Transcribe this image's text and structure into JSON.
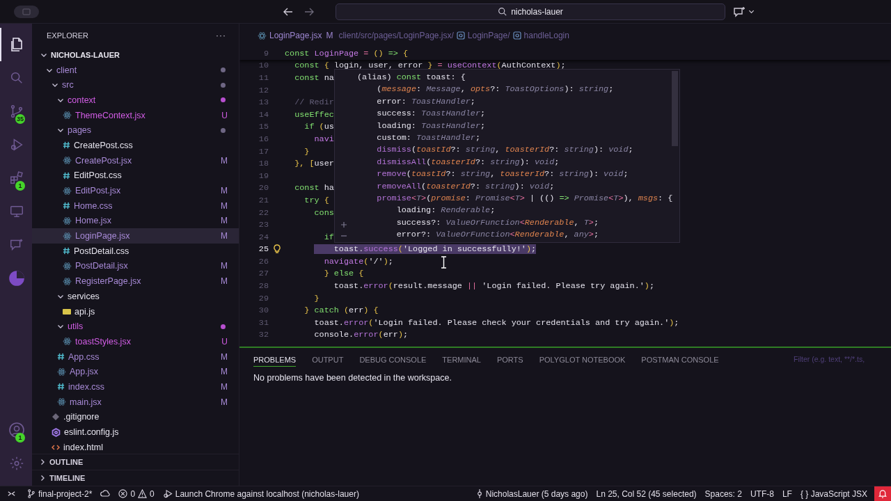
{
  "title_bar": {
    "search": "nicholas-lauer"
  },
  "activity_bar": {
    "top": [
      {
        "kind": "files",
        "selected": true
      },
      {
        "kind": "search",
        "selected": false
      },
      {
        "kind": "source-control",
        "selected": false,
        "badge": "35"
      },
      {
        "kind": "run-debug",
        "selected": false
      },
      {
        "kind": "extensions",
        "selected": false,
        "badge": "1"
      },
      {
        "kind": "remote",
        "selected": false
      },
      {
        "kind": "chat",
        "selected": false
      },
      {
        "kind": "pie",
        "selected": false
      }
    ],
    "bottom": [
      {
        "kind": "account",
        "selected": false,
        "badge": "1"
      },
      {
        "kind": "settings",
        "selected": false
      }
    ]
  },
  "explorer": {
    "title": "EXPLORER",
    "more": "···",
    "root": {
      "label": "NICHOLAS-LAUER",
      "kind": "folder",
      "expanded": true,
      "modified": false,
      "untracked": false,
      "selected": false,
      "children": [
        {
          "label": "client",
          "kind": "folder",
          "expanded": true,
          "modified": true,
          "untracked": false,
          "selected": false,
          "children": [
            {
              "label": "src",
              "kind": "folder",
              "expanded": true,
              "modified": true,
              "untracked": false,
              "selected": false,
              "children": [
                {
                  "label": "context",
                  "kind": "folder",
                  "expanded": true,
                  "modified": false,
                  "untracked": true,
                  "selected": false,
                  "children": [
                    {
                      "label": "ThemeContext.jsx",
                      "kind": "react",
                      "modified": false,
                      "untracked": true,
                      "badge": "U",
                      "selected": false
                    }
                  ]
                },
                {
                  "label": "pages",
                  "kind": "folder",
                  "expanded": true,
                  "modified": true,
                  "untracked": false,
                  "selected": false,
                  "children": [
                    {
                      "label": "CreatePost.css",
                      "kind": "css",
                      "modified": false,
                      "untracked": false,
                      "selected": false
                    },
                    {
                      "label": "CreatePost.jsx",
                      "kind": "react",
                      "modified": true,
                      "untracked": false,
                      "badge": "M",
                      "selected": false
                    },
                    {
                      "label": "EditPost.css",
                      "kind": "css",
                      "modified": false,
                      "untracked": false,
                      "selected": false
                    },
                    {
                      "label": "EditPost.jsx",
                      "kind": "react",
                      "modified": true,
                      "untracked": false,
                      "badge": "M",
                      "selected": false
                    },
                    {
                      "label": "Home.css",
                      "kind": "css",
                      "modified": true,
                      "untracked": false,
                      "badge": "M",
                      "selected": false
                    },
                    {
                      "label": "Home.jsx",
                      "kind": "react",
                      "modified": true,
                      "untracked": false,
                      "badge": "M",
                      "selected": false
                    },
                    {
                      "label": "LoginPage.jsx",
                      "kind": "react",
                      "modified": true,
                      "untracked": false,
                      "badge": "M",
                      "selected": true
                    },
                    {
                      "label": "PostDetail.css",
                      "kind": "css",
                      "modified": false,
                      "untracked": false,
                      "selected": false
                    },
                    {
                      "label": "PostDetail.jsx",
                      "kind": "react",
                      "modified": true,
                      "untracked": false,
                      "badge": "M",
                      "selected": false
                    },
                    {
                      "label": "RegisterPage.jsx",
                      "kind": "react",
                      "modified": true,
                      "untracked": false,
                      "badge": "M",
                      "selected": false
                    }
                  ]
                },
                {
                  "label": "services",
                  "kind": "folder",
                  "expanded": true,
                  "modified": false,
                  "untracked": false,
                  "selected": false,
                  "children": [
                    {
                      "label": "api.js",
                      "kind": "js",
                      "modified": false,
                      "untracked": false,
                      "selected": false
                    }
                  ]
                },
                {
                  "label": "utils",
                  "kind": "folder",
                  "expanded": true,
                  "modified": false,
                  "untracked": true,
                  "selected": false,
                  "children": [
                    {
                      "label": "toastStyles.jsx",
                      "kind": "react",
                      "modified": false,
                      "untracked": true,
                      "badge": "U",
                      "selected": false
                    }
                  ]
                },
                {
                  "label": "App.css",
                  "kind": "css",
                  "modified": true,
                  "untracked": false,
                  "badge": "M",
                  "selected": false
                },
                {
                  "label": "App.jsx",
                  "kind": "react",
                  "modified": true,
                  "untracked": false,
                  "badge": "M",
                  "selected": false
                },
                {
                  "label": "index.css",
                  "kind": "css",
                  "modified": true,
                  "untracked": false,
                  "badge": "M",
                  "selected": false
                },
                {
                  "label": "main.jsx",
                  "kind": "react",
                  "modified": true,
                  "untracked": false,
                  "badge": "M",
                  "selected": false
                }
              ]
            },
            {
              "label": ".gitignore",
              "kind": "git",
              "modified": false,
              "untracked": false,
              "selected": false
            },
            {
              "label": "eslint.config.js",
              "kind": "eslint",
              "modified": false,
              "untracked": false,
              "selected": false
            },
            {
              "label": "index.html",
              "kind": "html",
              "modified": false,
              "untracked": false,
              "selected": false
            }
          ]
        }
      ]
    },
    "sections": [
      {
        "label": "OUTLINE",
        "expanded": false
      },
      {
        "label": "TIMELINE",
        "expanded": false
      }
    ]
  },
  "breadcrumbs": {
    "file": "LoginPage.jsx",
    "badge": "M",
    "path": "client/src/pages/LoginPage.jsx/",
    "symbols": [
      "LoginPage/",
      "handleLogin"
    ]
  },
  "editor": {
    "sticky_line": {
      "number": "9",
      "tokens": [
        {
          "kind": "kw",
          "text": "const "
        },
        {
          "kind": "fn",
          "text": "LoginPage"
        },
        {
          "kind": "op",
          "text": " = "
        },
        {
          "kind": "punc",
          "text": "() "
        },
        {
          "kind": "kw",
          "text": "=> "
        },
        {
          "kind": "punc",
          "text": "{"
        }
      ]
    },
    "lines": [
      {
        "number": "10",
        "selected": false,
        "tokens": [
          {
            "kind": "kw",
            "text": "  const "
          },
          {
            "kind": "punc",
            "text": "{ "
          },
          {
            "kind": "plain",
            "text": "login, user, error "
          },
          {
            "kind": "punc",
            "text": "} "
          },
          {
            "kind": "op",
            "text": "= "
          },
          {
            "kind": "fn",
            "text": "useContext"
          },
          {
            "kind": "punc",
            "text": "("
          },
          {
            "kind": "plain",
            "text": "AuthContext"
          },
          {
            "kind": "punc",
            "text": ")"
          },
          {
            "kind": "plain",
            "text": ";"
          }
        ]
      },
      {
        "number": "11",
        "selected": false,
        "tokens": [
          {
            "kind": "kw",
            "text": "  const "
          },
          {
            "kind": "plain",
            "text": "na"
          }
        ]
      },
      {
        "number": "12",
        "selected": false
      },
      {
        "number": "13",
        "selected": false,
        "tokens": [
          {
            "kind": "comment",
            "text": "  // Redir"
          }
        ]
      },
      {
        "number": "14",
        "selected": false,
        "tokens": [
          {
            "kind": "kw",
            "text": "  useEffec"
          }
        ]
      },
      {
        "number": "15",
        "selected": false,
        "tokens": [
          {
            "kind": "kw",
            "text": "    if "
          },
          {
            "kind": "punc",
            "text": "("
          },
          {
            "kind": "plain",
            "text": "us"
          }
        ]
      },
      {
        "number": "16",
        "selected": false,
        "tokens": [
          {
            "kind": "fn",
            "text": "      navi"
          }
        ]
      },
      {
        "number": "17",
        "selected": false,
        "tokens": [
          {
            "kind": "punc",
            "text": "    }"
          }
        ]
      },
      {
        "number": "18",
        "selected": false,
        "tokens": [
          {
            "kind": "punc",
            "text": "  }, ["
          },
          {
            "kind": "plain",
            "text": "user"
          }
        ]
      },
      {
        "number": "19",
        "selected": false
      },
      {
        "number": "20",
        "selected": false,
        "tokens": [
          {
            "kind": "kw",
            "text": "  const "
          },
          {
            "kind": "plain",
            "text": "ha"
          }
        ]
      },
      {
        "number": "21",
        "selected": false,
        "tokens": [
          {
            "kind": "kw",
            "text": "    try "
          },
          {
            "kind": "punc",
            "text": "{"
          }
        ]
      },
      {
        "number": "22",
        "selected": false,
        "tokens": [
          {
            "kind": "kw",
            "text": "      cons"
          }
        ]
      },
      {
        "number": "23",
        "selected": false
      },
      {
        "number": "24",
        "selected": false,
        "tokens": [
          {
            "kind": "kw",
            "text": "        if"
          }
        ]
      },
      {
        "number": "25",
        "selected": true,
        "tokens": [
          {
            "kind": "plain",
            "text": "          toast."
          },
          {
            "kind": "method",
            "text": "success"
          },
          {
            "kind": "punc",
            "text": "("
          },
          {
            "kind": "str",
            "text": "'Logged in successfully!'"
          },
          {
            "kind": "punc",
            "text": ")"
          },
          {
            "kind": "plain",
            "text": ";"
          }
        ]
      },
      {
        "number": "26",
        "selected": false,
        "tokens": [
          {
            "kind": "fn",
            "text": "        navigate"
          },
          {
            "kind": "punc",
            "text": "("
          },
          {
            "kind": "str",
            "text": "'/'"
          },
          {
            "kind": "punc",
            "text": ")"
          },
          {
            "kind": "plain",
            "text": ";"
          }
        ]
      },
      {
        "number": "27",
        "selected": false,
        "tokens": [
          {
            "kind": "punc",
            "text": "        } "
          },
          {
            "kind": "kw",
            "text": "else "
          },
          {
            "kind": "punc",
            "text": "{"
          }
        ]
      },
      {
        "number": "28",
        "selected": false,
        "tokens": [
          {
            "kind": "plain",
            "text": "          toast."
          },
          {
            "kind": "method",
            "text": "error"
          },
          {
            "kind": "punc",
            "text": "("
          },
          {
            "kind": "plain",
            "text": "result.message "
          },
          {
            "kind": "op",
            "text": "|| "
          },
          {
            "kind": "str",
            "text": "'Login failed. Please try again.'"
          },
          {
            "kind": "punc",
            "text": ")"
          },
          {
            "kind": "plain",
            "text": ";"
          }
        ]
      },
      {
        "number": "29",
        "selected": false,
        "tokens": [
          {
            "kind": "punc",
            "text": "      }"
          }
        ]
      },
      {
        "number": "30",
        "selected": false,
        "tokens": [
          {
            "kind": "punc",
            "text": "    } "
          },
          {
            "kind": "kw",
            "text": "catch "
          },
          {
            "kind": "punc",
            "text": "("
          },
          {
            "kind": "plain",
            "text": "err"
          },
          {
            "kind": "punc",
            "text": ") {"
          }
        ]
      },
      {
        "number": "31",
        "selected": false,
        "tokens": [
          {
            "kind": "plain",
            "text": "      toast."
          },
          {
            "kind": "method",
            "text": "error"
          },
          {
            "kind": "punc",
            "text": "("
          },
          {
            "kind": "str",
            "text": "'Login failed. Please check your credentials and try again.'"
          },
          {
            "kind": "punc",
            "text": ")"
          },
          {
            "kind": "plain",
            "text": ";"
          }
        ]
      },
      {
        "number": "32",
        "selected": false,
        "tokens": [
          {
            "kind": "plain",
            "text": "      console."
          },
          {
            "kind": "method",
            "text": "error"
          },
          {
            "kind": "punc",
            "text": "("
          },
          {
            "kind": "plain",
            "text": "err"
          },
          {
            "kind": "punc",
            "text": ")"
          },
          {
            "kind": "plain",
            "text": ";"
          }
        ]
      }
    ],
    "hover": {
      "lines": [
        [
          {
            "kind": "plain",
            "text": "(alias) "
          },
          {
            "kind": "kw",
            "text": "const "
          },
          {
            "kind": "plain",
            "text": "toast"
          },
          {
            "kind": "plain",
            "text": ": {"
          }
        ],
        [
          {
            "kind": "plain",
            "text": "    ("
          },
          {
            "kind": "param",
            "text": "message"
          },
          {
            "kind": "plain",
            "text": ": "
          },
          {
            "kind": "type",
            "text": "Message"
          },
          {
            "kind": "plain",
            "text": ", "
          },
          {
            "kind": "param",
            "text": "opts"
          },
          {
            "kind": "plain",
            "text": "?: "
          },
          {
            "kind": "type",
            "text": "ToastOptions"
          },
          {
            "kind": "plain",
            "text": "): "
          },
          {
            "kind": "type",
            "text": "string"
          },
          {
            "kind": "plain",
            "text": ";"
          }
        ],
        [
          {
            "kind": "plain",
            "text": "    error: "
          },
          {
            "kind": "type",
            "text": "ToastHandler"
          },
          {
            "kind": "plain",
            "text": ";"
          }
        ],
        [
          {
            "kind": "plain",
            "text": "    success: "
          },
          {
            "kind": "type",
            "text": "ToastHandler"
          },
          {
            "kind": "plain",
            "text": ";"
          }
        ],
        [
          {
            "kind": "plain",
            "text": "    loading: "
          },
          {
            "kind": "type",
            "text": "ToastHandler"
          },
          {
            "kind": "plain",
            "text": ";"
          }
        ],
        [
          {
            "kind": "plain",
            "text": "    custom: "
          },
          {
            "kind": "type",
            "text": "ToastHandler"
          },
          {
            "kind": "plain",
            "text": ";"
          }
        ],
        [
          {
            "kind": "method",
            "text": "    dismiss"
          },
          {
            "kind": "plain",
            "text": "("
          },
          {
            "kind": "param",
            "text": "toastId"
          },
          {
            "kind": "plain",
            "text": "?: "
          },
          {
            "kind": "type",
            "text": "string"
          },
          {
            "kind": "plain",
            "text": ", "
          },
          {
            "kind": "param",
            "text": "toasterId"
          },
          {
            "kind": "plain",
            "text": "?: "
          },
          {
            "kind": "type",
            "text": "string"
          },
          {
            "kind": "plain",
            "text": "): "
          },
          {
            "kind": "type",
            "text": "void"
          },
          {
            "kind": "plain",
            "text": ";"
          }
        ],
        [
          {
            "kind": "method",
            "text": "    dismissAll"
          },
          {
            "kind": "plain",
            "text": "("
          },
          {
            "kind": "param",
            "text": "toasterId"
          },
          {
            "kind": "plain",
            "text": "?: "
          },
          {
            "kind": "type",
            "text": "string"
          },
          {
            "kind": "plain",
            "text": "): "
          },
          {
            "kind": "type",
            "text": "void"
          },
          {
            "kind": "plain",
            "text": ";"
          }
        ],
        [
          {
            "kind": "method",
            "text": "    remove"
          },
          {
            "kind": "plain",
            "text": "("
          },
          {
            "kind": "param",
            "text": "toastId"
          },
          {
            "kind": "plain",
            "text": "?: "
          },
          {
            "kind": "type",
            "text": "string"
          },
          {
            "kind": "plain",
            "text": ", "
          },
          {
            "kind": "param",
            "text": "toasterId"
          },
          {
            "kind": "plain",
            "text": "?: "
          },
          {
            "kind": "type",
            "text": "string"
          },
          {
            "kind": "plain",
            "text": "): "
          },
          {
            "kind": "type",
            "text": "void"
          },
          {
            "kind": "plain",
            "text": ";"
          }
        ],
        [
          {
            "kind": "method",
            "text": "    removeAll"
          },
          {
            "kind": "plain",
            "text": "("
          },
          {
            "kind": "param",
            "text": "toasterId"
          },
          {
            "kind": "plain",
            "text": "?: "
          },
          {
            "kind": "type",
            "text": "string"
          },
          {
            "kind": "plain",
            "text": "): "
          },
          {
            "kind": "type",
            "text": "void"
          },
          {
            "kind": "plain",
            "text": ";"
          }
        ],
        [
          {
            "kind": "method",
            "text": "    promise"
          },
          {
            "kind": "op",
            "text": "<"
          },
          {
            "kind": "type",
            "text": "T"
          },
          {
            "kind": "op",
            "text": ">"
          },
          {
            "kind": "plain",
            "text": "("
          },
          {
            "kind": "param",
            "text": "promise"
          },
          {
            "kind": "plain",
            "text": ": "
          },
          {
            "kind": "type",
            "text": "Promise"
          },
          {
            "kind": "op",
            "text": "<"
          },
          {
            "kind": "type",
            "text": "T"
          },
          {
            "kind": "op",
            "text": ">"
          },
          {
            "kind": "plain",
            "text": " | (() "
          },
          {
            "kind": "kw",
            "text": "=> "
          },
          {
            "kind": "type",
            "text": "Promise"
          },
          {
            "kind": "op",
            "text": "<"
          },
          {
            "kind": "type",
            "text": "T"
          },
          {
            "kind": "op",
            "text": ">"
          },
          {
            "kind": "plain",
            "text": "), "
          },
          {
            "kind": "param",
            "text": "msgs"
          },
          {
            "kind": "plain",
            "text": ": {"
          }
        ],
        [
          {
            "kind": "plain",
            "text": "        loading: "
          },
          {
            "kind": "type",
            "text": "Renderable"
          },
          {
            "kind": "plain",
            "text": ";"
          }
        ],
        [
          {
            "kind": "plain",
            "text": "        success?: "
          },
          {
            "kind": "type",
            "text": "ValueOrFunction"
          },
          {
            "kind": "op",
            "text": "<"
          },
          {
            "kind": "param",
            "text": "Renderable"
          },
          {
            "kind": "plain",
            "text": ", "
          },
          {
            "kind": "type",
            "text": "T"
          },
          {
            "kind": "op",
            "text": ">"
          },
          {
            "kind": "plain",
            "text": ";"
          }
        ],
        [
          {
            "kind": "plain",
            "text": "        error?: "
          },
          {
            "kind": "type",
            "text": "ValueOrFunction"
          },
          {
            "kind": "op",
            "text": "<"
          },
          {
            "kind": "param",
            "text": "Renderable"
          },
          {
            "kind": "plain",
            "text": ", "
          },
          {
            "kind": "type",
            "text": "any"
          },
          {
            "kind": "op",
            "text": ">"
          },
          {
            "kind": "plain",
            "text": ";"
          }
        ]
      ]
    }
  },
  "panel": {
    "tabs": [
      {
        "label": "PROBLEMS",
        "selected": true
      },
      {
        "label": "OUTPUT",
        "selected": false
      },
      {
        "label": "DEBUG CONSOLE",
        "selected": false
      },
      {
        "label": "TERMINAL",
        "selected": false
      },
      {
        "label": "PORTS",
        "selected": false
      },
      {
        "label": "POLYGLOT NOTEBOOK",
        "selected": false
      },
      {
        "label": "POSTMAN CONSOLE",
        "selected": false
      }
    ],
    "filter": {
      "placeholder": "Filter (e.g. text, **/*.ts,"
    },
    "message": "No problems have been detected in the workspace."
  },
  "status_bar": {
    "left": [
      {
        "kind": "remote"
      },
      {
        "kind": "branch",
        "text": "final-project-2*"
      },
      {
        "kind": "sync"
      },
      {
        "kind": "problems",
        "errors": "0",
        "warnings": "0"
      },
      {
        "kind": "debug",
        "text": "Launch Chrome against localhost (nicholas-lauer)"
      }
    ],
    "right": [
      {
        "kind": "commit",
        "text": "NicholasLauer (5 days ago)"
      },
      {
        "kind": "text",
        "text": "Ln 25, Col 52 (45 selected)"
      },
      {
        "kind": "text",
        "text": "Spaces: 2"
      },
      {
        "kind": "text",
        "text": "UTF-8"
      },
      {
        "kind": "text",
        "text": "LF"
      },
      {
        "kind": "language",
        "symbol": "{ }",
        "text": "JavaScript JSX"
      },
      {
        "kind": "bell"
      }
    ]
  }
}
